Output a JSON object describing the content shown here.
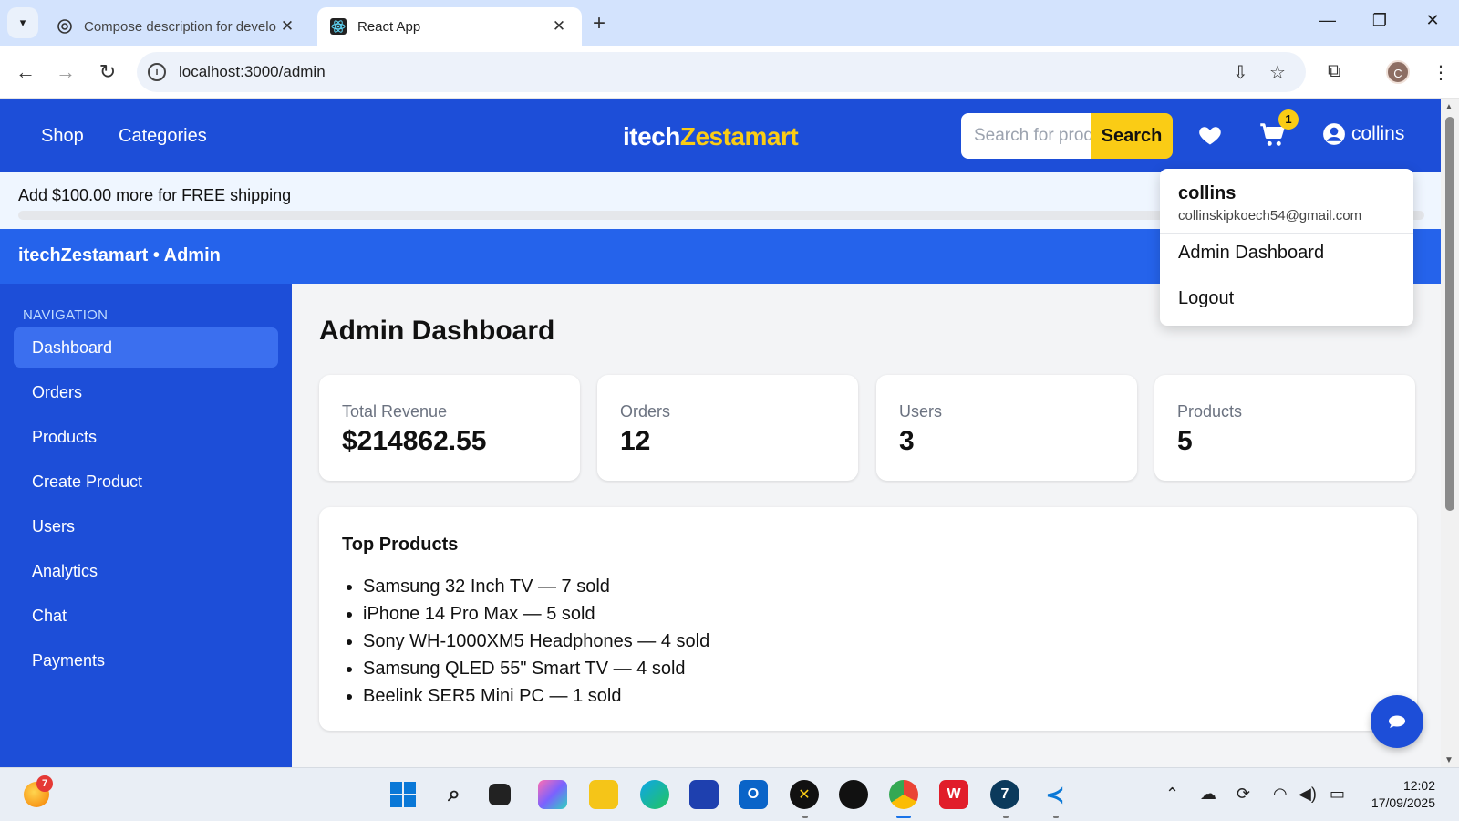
{
  "browser": {
    "tabs": [
      {
        "title": "Compose description for develo",
        "icon": "openai-icon"
      },
      {
        "title": "React App",
        "icon": "react-icon"
      }
    ],
    "url": "localhost:3000/admin",
    "profile_initial": "C"
  },
  "site": {
    "nav": {
      "shop": "Shop",
      "categories": "Categories"
    },
    "logo": {
      "part1": "itech",
      "part2": "Zestamart"
    },
    "search": {
      "placeholder": "Search for products",
      "button": "Search"
    },
    "cart_count": "1",
    "username": "collins"
  },
  "shipping": {
    "message": "Add $100.00 more for FREE shipping",
    "progress": 0
  },
  "admin": {
    "title": "itechZestamart • Admin"
  },
  "sidebar": {
    "heading": "NAVIGATION",
    "items": [
      {
        "label": "Dashboard",
        "active": true
      },
      {
        "label": "Orders"
      },
      {
        "label": "Products"
      },
      {
        "label": "Create Product"
      },
      {
        "label": "Users"
      },
      {
        "label": "Analytics"
      },
      {
        "label": "Chat"
      },
      {
        "label": "Payments"
      }
    ]
  },
  "dashboard": {
    "title": "Admin Dashboard",
    "stats": [
      {
        "label": "Total Revenue",
        "value": "$214862.55"
      },
      {
        "label": "Orders",
        "value": "12"
      },
      {
        "label": "Users",
        "value": "3"
      },
      {
        "label": "Products",
        "value": "5"
      }
    ],
    "top_products": {
      "title": "Top Products",
      "items": [
        "Samsung 32 Inch TV — 7 sold",
        "iPhone 14 Pro Max — 5 sold",
        "Sony WH-1000XM5 Headphones — 4 sold",
        "Samsung QLED 55\" Smart TV — 4 sold",
        "Beelink SER5 Mini PC — 1 sold"
      ]
    }
  },
  "user_menu": {
    "name": "collins",
    "email": "collinskipkoech54@gmail.com",
    "items": [
      "Admin Dashboard",
      "Logout"
    ]
  },
  "taskbar": {
    "weather_badge": "7",
    "time": "12:02",
    "date": "17/09/2025"
  },
  "colors": {
    "primary": "#1d4ed8",
    "accent": "#facc15",
    "admin_bar": "#2563eb"
  }
}
